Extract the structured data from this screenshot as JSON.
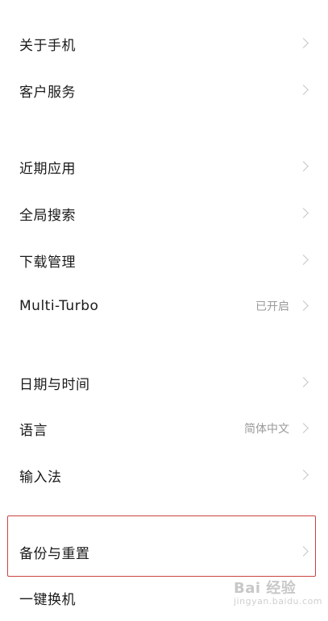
{
  "settings": {
    "items": [
      {
        "label": "关于手机",
        "value": ""
      },
      {
        "label": "客户服务",
        "value": ""
      },
      {
        "label": "近期应用",
        "value": ""
      },
      {
        "label": "全局搜索",
        "value": ""
      },
      {
        "label": "下载管理",
        "value": ""
      },
      {
        "label": "Multi-Turbo",
        "value": "已开启"
      },
      {
        "label": "日期与时间",
        "value": ""
      },
      {
        "label": "语言",
        "value": "简体中文"
      },
      {
        "label": "输入法",
        "value": ""
      },
      {
        "label": "备份与重置",
        "value": ""
      },
      {
        "label": "一键换机",
        "value": ""
      }
    ]
  },
  "watermark": {
    "brand": "Bai 经验",
    "url": "jingyan.baidu.com"
  }
}
